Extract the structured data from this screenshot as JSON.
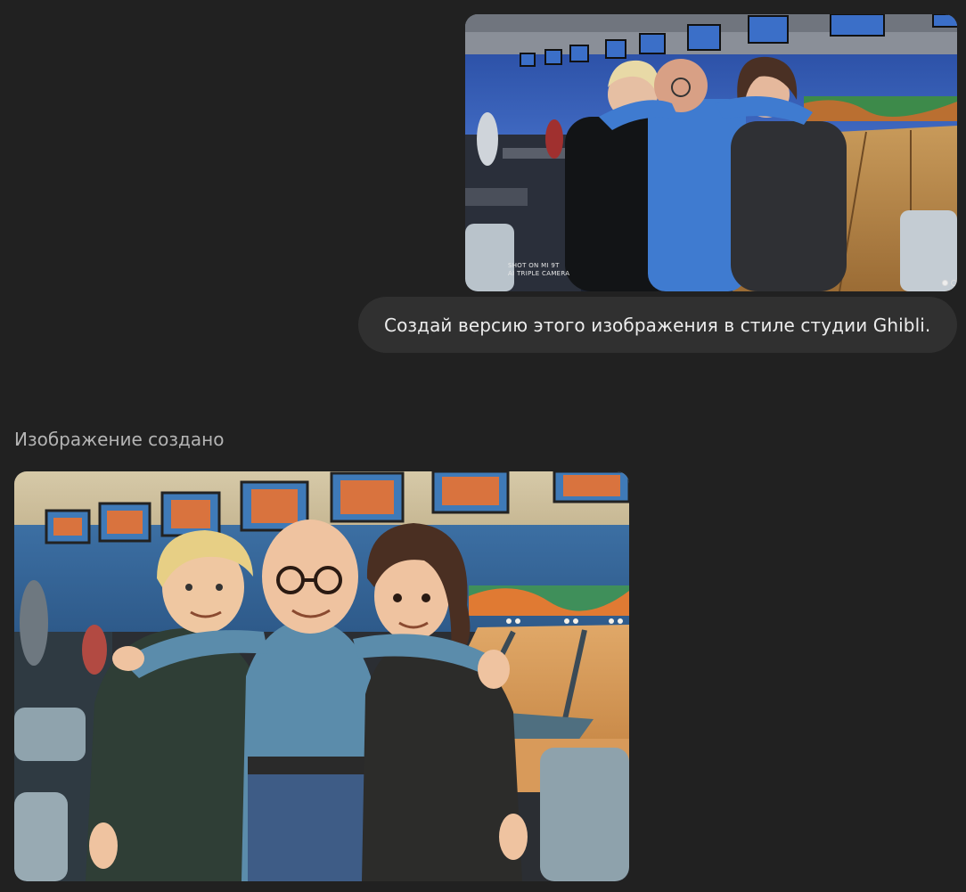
{
  "conversation": {
    "user_message": {
      "image_alt": "photo-three-people-bowling-alley",
      "watermark_line1": "SHOT ON MI 9T",
      "watermark_line2": "AI TRIPLE CAMERA",
      "text": "Создай версию этого изображения в стиле студии Ghibli."
    },
    "assistant_message": {
      "status": "Изображение создано",
      "image_alt": "ghibli-style-illustration-three-people-bowling-alley"
    }
  },
  "colors": {
    "page_background": "#212121",
    "bubble_background": "#303030",
    "bubble_text": "#ececec",
    "status_text": "#b4b4b4"
  }
}
